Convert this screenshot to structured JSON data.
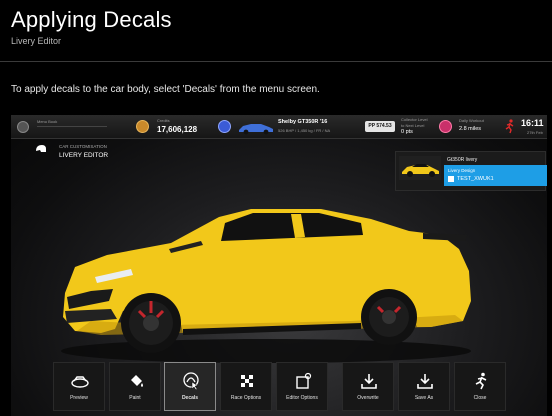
{
  "header": {
    "title": "Applying Decals",
    "subtitle": "Livery Editor",
    "instruction": "To apply decals to the car body, select 'Decals' from the menu screen."
  },
  "topbar": {
    "left_label": "Menu Book",
    "credits_label": "Credits",
    "credits_value": "17,606,128",
    "car_name": "Shelby GT350R '16",
    "car_specs": "526 BHP / 1,450 kg / FR / NA",
    "pp_value": "PP 574.53",
    "collector_label": "Collector Level",
    "collector_sub": "to Next Level",
    "collector_value": "0 pts",
    "workout_label": "Daily Workout",
    "workout_value": "2.8 miles",
    "clock": "16:11",
    "date": "27th Feb"
  },
  "customisation": {
    "small_label": "CAR CUSTOMISATION",
    "main_label": "LIVERY EDITOR"
  },
  "livery": {
    "name": "Gt350R livery",
    "design_label": "Livery Design",
    "user": "TEST_XWUK1"
  },
  "menu": {
    "items": [
      {
        "label": "Preview",
        "icon": "car-view-icon"
      },
      {
        "label": "Paint",
        "icon": "paint-bucket-icon"
      },
      {
        "label": "Decals",
        "icon": "decals-icon",
        "selected": true
      },
      {
        "label": "Race Options",
        "icon": "checkered-flag-icon"
      },
      {
        "label": "Editor Options",
        "icon": "editor-options-icon"
      },
      {
        "label": "Overwrite",
        "icon": "download-icon"
      },
      {
        "label": "Save As",
        "icon": "download-icon"
      },
      {
        "label": "Close",
        "icon": "running-man-icon"
      }
    ]
  },
  "colors": {
    "car_body": "#f2c81a",
    "accent_blue": "#1e9ee6",
    "background": "#000000"
  }
}
